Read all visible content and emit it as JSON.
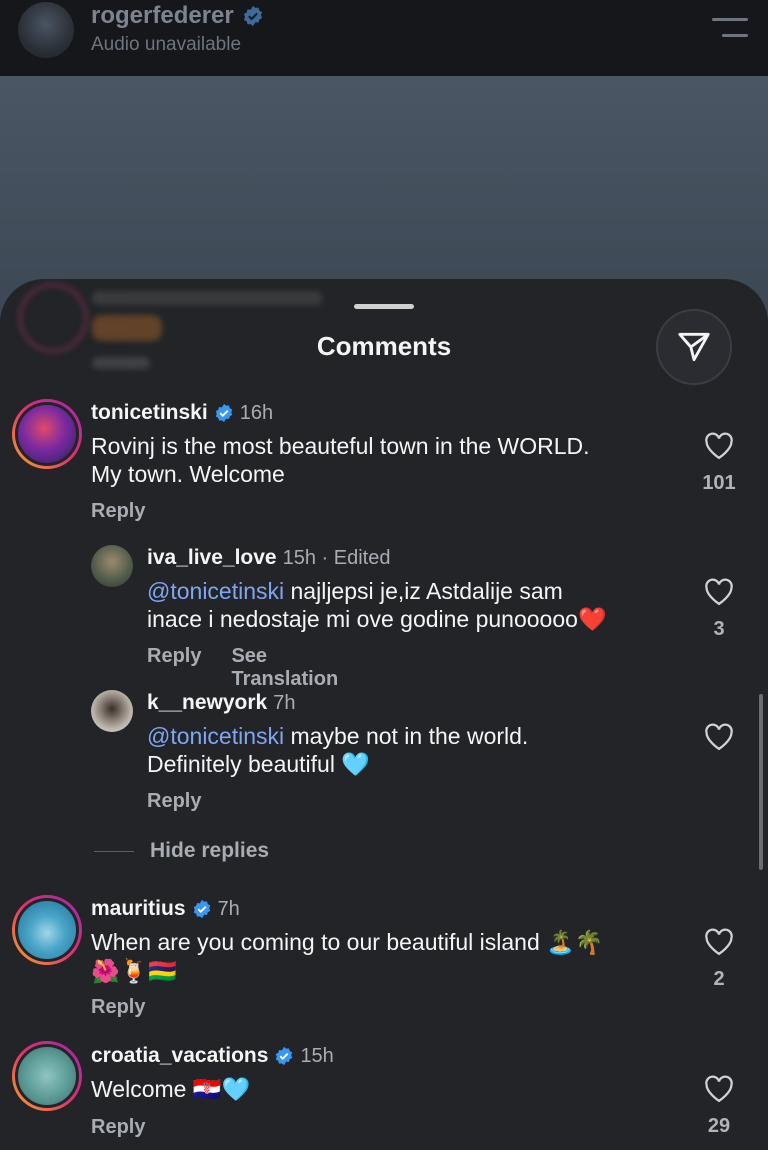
{
  "header": {
    "username": "rogerfederer",
    "subtitle": "Audio unavailable"
  },
  "sheet": {
    "title": "Comments"
  },
  "comments": [
    {
      "username": "tonicetinski",
      "verified": true,
      "time": "16h",
      "line1": "Rovinj is the most beauteful town in the WORLD.",
      "line2": "My town. Welcome",
      "reply": "Reply",
      "likes": "101"
    },
    {
      "username": "iva_live_love",
      "time": "15h · Edited",
      "mention": "@tonicetinski",
      "line1": " najljepsi je,iz Astdalije sam",
      "line2": "inace i nedostaje mi ove godine punooooo",
      "emoji": "❤️",
      "reply": "Reply",
      "translate": "See Translation",
      "likes": "3"
    },
    {
      "username": "k__newyork",
      "time": "7h",
      "mention": "@tonicetinski",
      "line1": " maybe not in the world.",
      "line2": "Definitely beautiful",
      "emoji": "🩵",
      "reply": "Reply"
    },
    {
      "username": "mauritius",
      "verified": true,
      "time": "7h",
      "line1": "When are you coming to our beautiful island",
      "emoji1": "🏝️🌴",
      "emoji2": "🌺🍹🇲🇺",
      "reply": "Reply",
      "likes": "2"
    },
    {
      "username": "croatia_vacations",
      "verified": true,
      "time": "15h",
      "line1": "Welcome",
      "emoji": "🇭🇷🩵",
      "reply": "Reply",
      "likes": "29"
    }
  ],
  "hide_replies": "Hide replies",
  "colors": {
    "background": "#222428",
    "mention": "#7fa6f2",
    "verified": "#3897f0",
    "secondary_text": "#a8acb3"
  }
}
